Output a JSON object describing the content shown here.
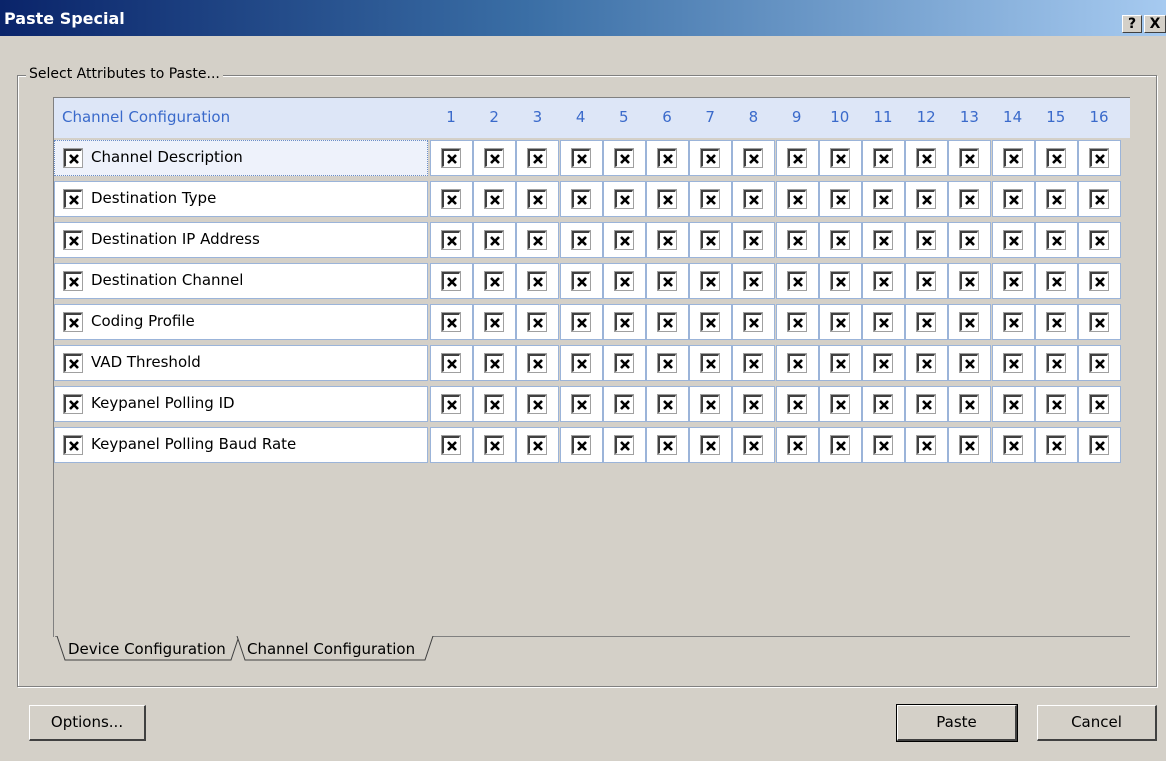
{
  "window": {
    "title": "Paste Special",
    "help_glyph": "?",
    "close_glyph": "X"
  },
  "group": {
    "label": "Select Attributes to Paste..."
  },
  "grid": {
    "header_label": "Channel Configuration",
    "columns": [
      "1",
      "2",
      "3",
      "4",
      "5",
      "6",
      "7",
      "8",
      "9",
      "10",
      "11",
      "12",
      "13",
      "14",
      "15",
      "16"
    ],
    "rows": [
      {
        "label": "Channel Description",
        "checked": true
      },
      {
        "label": "Destination Type",
        "checked": true
      },
      {
        "label": "Destination IP Address",
        "checked": true
      },
      {
        "label": "Destination Channel",
        "checked": true
      },
      {
        "label": "Coding Profile",
        "checked": true
      },
      {
        "label": "VAD Threshold",
        "checked": true
      },
      {
        "label": "Keypanel Polling ID",
        "checked": true
      },
      {
        "label": "Keypanel Polling Baud Rate",
        "checked": true
      }
    ]
  },
  "tabs": [
    {
      "label": "Device Configuration",
      "active": false
    },
    {
      "label": "Channel Configuration",
      "active": true
    }
  ],
  "buttons": {
    "options": "Options...",
    "paste": "Paste",
    "cancel": "Cancel"
  },
  "colors": {
    "titlebar_start": "#0a246a",
    "header_text": "#3a6acb",
    "header_bg": "#dde6f7"
  }
}
